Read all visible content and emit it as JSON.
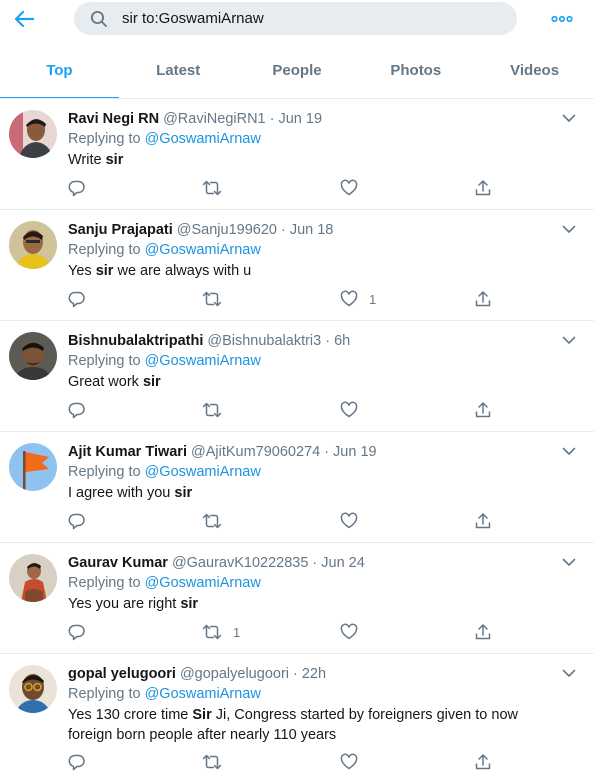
{
  "header": {
    "search_value": "sir to:GoswamiArnaw",
    "back_icon": "arrow-left-icon",
    "search_icon": "search-icon",
    "more_icon": "more-horizontal-icon",
    "accent_color": "#1da1f2"
  },
  "tabs": [
    {
      "label": "Top",
      "active": true
    },
    {
      "label": "Latest",
      "active": false
    },
    {
      "label": "People",
      "active": false
    },
    {
      "label": "Photos",
      "active": false
    },
    {
      "label": "Videos",
      "active": false
    }
  ],
  "tweets": [
    {
      "name": "Ravi Negi RN",
      "handle": "@RaviNegiRN1",
      "time": "Jun 19",
      "replying_prefix": "Replying to ",
      "replying_to": "@GoswamiArnaw",
      "text_before": "Write ",
      "text_bold": "sir",
      "text_after": "",
      "reply_count": "",
      "retweet_count": "",
      "like_count": ""
    },
    {
      "name": "Sanju Prajapati",
      "handle": "@Sanju199620",
      "time": "Jun 18",
      "replying_prefix": "Replying to ",
      "replying_to": "@GoswamiArnaw",
      "text_before": "Yes ",
      "text_bold": "sir",
      "text_after": " we are always with u",
      "reply_count": "",
      "retweet_count": "",
      "like_count": "1"
    },
    {
      "name": "Bishnubalaktripathi",
      "handle": "@Bishnubalaktri3",
      "time": "6h",
      "replying_prefix": "Replying to ",
      "replying_to": "@GoswamiArnaw",
      "text_before": "Great work ",
      "text_bold": "sir",
      "text_after": "",
      "reply_count": "",
      "retweet_count": "",
      "like_count": ""
    },
    {
      "name": "Ajit Kumar Tiwari",
      "handle": "@AjitKum79060274",
      "time": "Jun 19",
      "replying_prefix": "Replying to ",
      "replying_to": "@GoswamiArnaw",
      "text_before": "I agree with you ",
      "text_bold": "sir",
      "text_after": "",
      "reply_count": "",
      "retweet_count": "",
      "like_count": ""
    },
    {
      "name": "Gaurav Kumar",
      "handle": "@GauravK10222835",
      "time": "Jun 24",
      "replying_prefix": "Replying to ",
      "replying_to": "@GoswamiArnaw",
      "text_before": "Yes you are right ",
      "text_bold": "sir",
      "text_after": "",
      "reply_count": "",
      "retweet_count": "1",
      "like_count": ""
    },
    {
      "name": "gopal yelugoori",
      "handle": "@gopalyelugoori",
      "time": "22h",
      "replying_prefix": "Replying to ",
      "replying_to": "@GoswamiArnaw",
      "text_before": "Yes 130 crore time ",
      "text_bold": "Sir",
      "text_after": " Ji, Congress started by  foreigners given to now foreign born people after nearly 110 years",
      "reply_count": "",
      "retweet_count": "",
      "like_count": ""
    }
  ],
  "action_icons": [
    "reply-icon",
    "retweet-icon",
    "like-icon",
    "share-icon"
  ],
  "dot_separator": "·"
}
